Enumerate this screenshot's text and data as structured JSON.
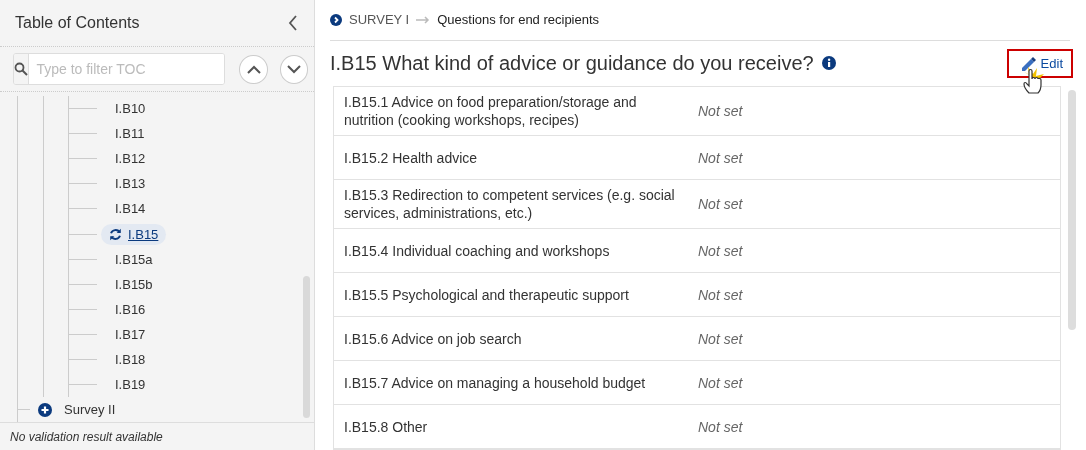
{
  "sidebar": {
    "title": "Table of Contents",
    "filter": {
      "placeholder": "Type to filter TOC"
    },
    "tree": [
      {
        "label": "I.B10",
        "selected": false
      },
      {
        "label": "I.B11",
        "selected": false
      },
      {
        "label": "I.B12",
        "selected": false
      },
      {
        "label": "I.B13",
        "selected": false
      },
      {
        "label": "I.B14",
        "selected": false
      },
      {
        "label": "I.B15",
        "selected": true
      },
      {
        "label": "I.B15a",
        "selected": false
      },
      {
        "label": "I.B15b",
        "selected": false
      },
      {
        "label": "I.B16",
        "selected": false
      },
      {
        "label": "I.B17",
        "selected": false
      },
      {
        "label": "I.B18",
        "selected": false
      },
      {
        "label": "I.B19",
        "selected": false
      }
    ],
    "root_items": [
      {
        "label": "Survey II",
        "expanded": false
      }
    ],
    "status": "No validation result available"
  },
  "breadcrumb": [
    "SURVEY I",
    "Questions for end recipients"
  ],
  "question": {
    "title": "I.B15 What kind of advice or guidance do you receive?",
    "edit_button": "Edit"
  },
  "answers": [
    {
      "label": "I.B15.1 Advice on food preparation/storage and nutrition (cooking workshops, recipes)",
      "value": "Not set"
    },
    {
      "label": "I.B15.2 Health advice",
      "value": "Not set"
    },
    {
      "label": "I.B15.3 Redirection to competent services (e.g. social services, administrations, etc.)",
      "value": "Not set"
    },
    {
      "label": "I.B15.4 Individual coaching and workshops",
      "value": "Not set"
    },
    {
      "label": "I.B15.5 Psychological and therapeutic support",
      "value": "Not set"
    },
    {
      "label": "I.B15.6 Advice on job search",
      "value": "Not set"
    },
    {
      "label": "I.B15.7 Advice on managing a household budget",
      "value": "Not set"
    },
    {
      "label": "I.B15.8 Other",
      "value": "Not set"
    }
  ]
}
